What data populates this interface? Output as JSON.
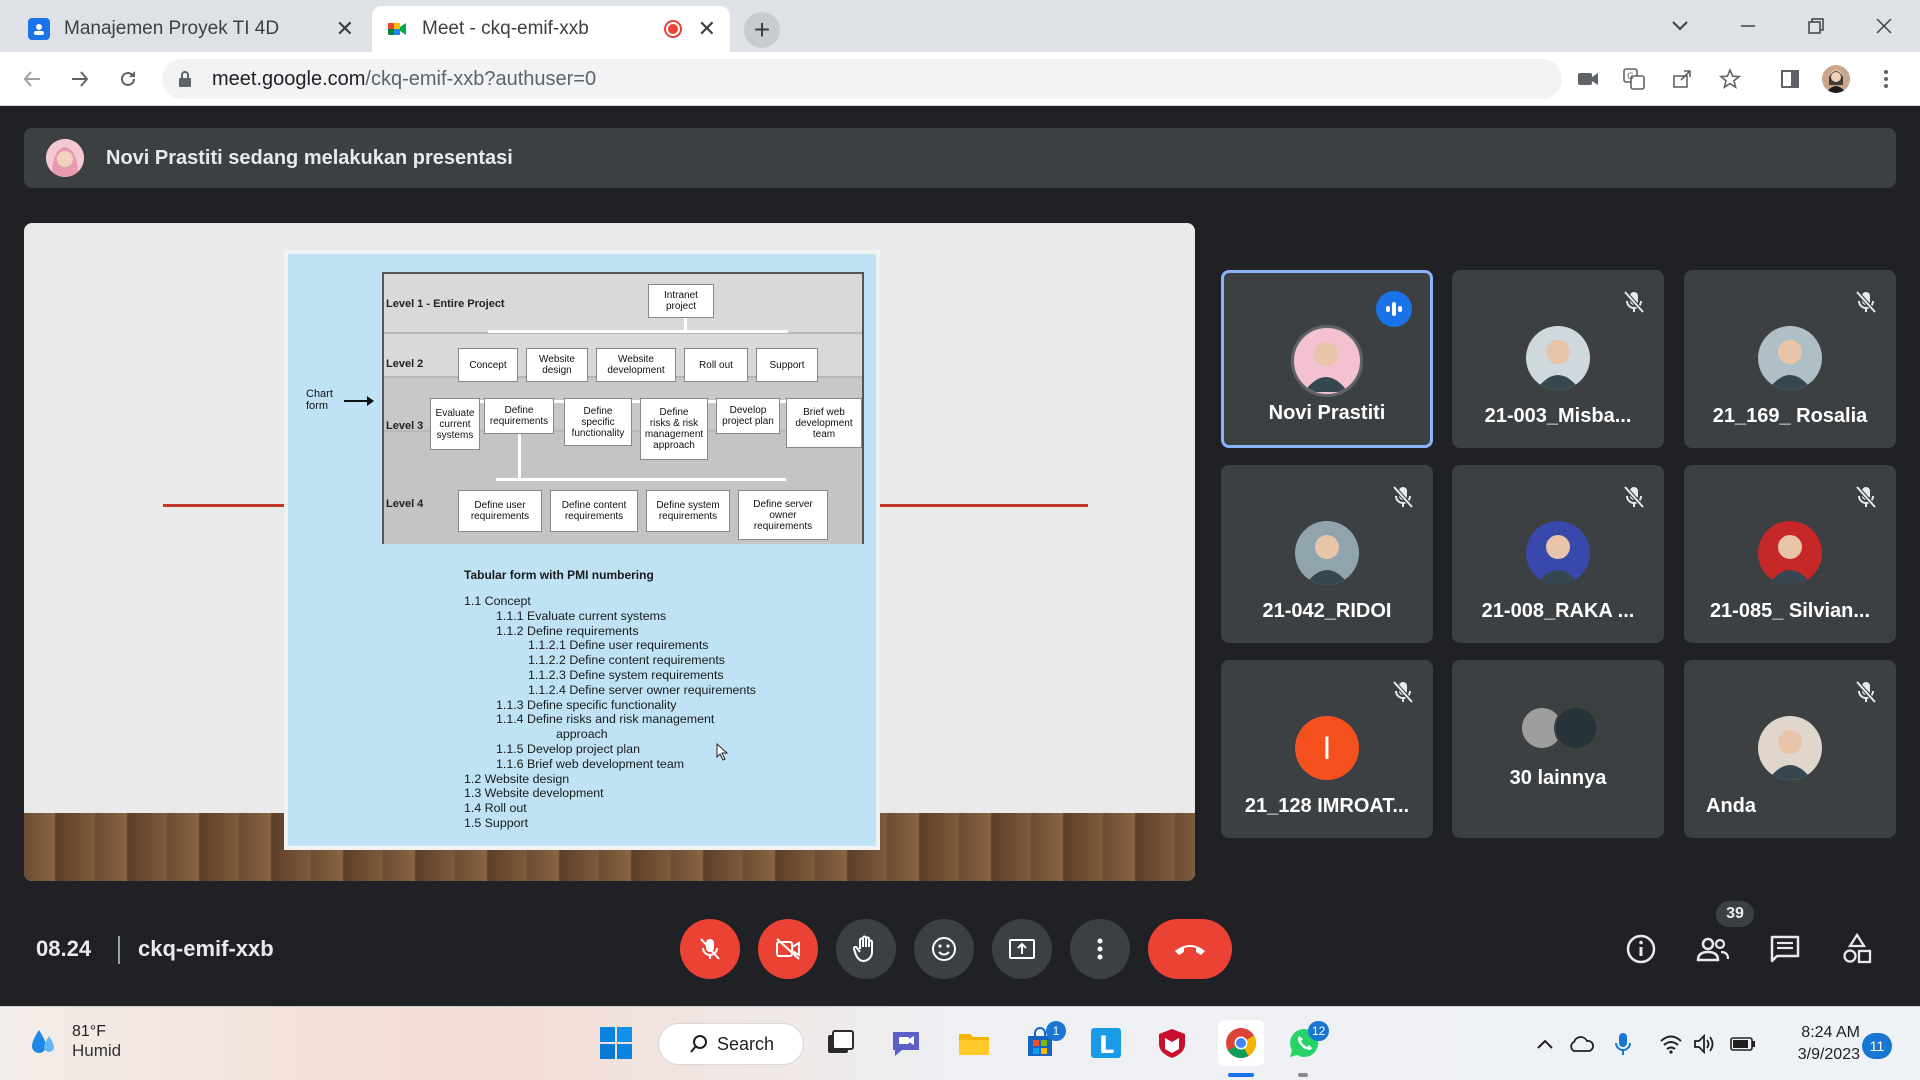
{
  "browser": {
    "tabs": [
      {
        "title": "Manajemen Proyek TI 4D",
        "close": "✕"
      },
      {
        "title": "Meet - ckq-emif-xxb",
        "close": "✕"
      }
    ],
    "url_host": "meet.google.com",
    "url_path": "/ckq-emif-xxb?authuser=0"
  },
  "meet": {
    "presenter_text": "Novi Prastiti sedang melakukan presentasi",
    "meeting_time": "08.24",
    "meeting_code": "ckq-emif-xxb",
    "participant_count": "39",
    "colors": {
      "accent": "#8ab4f8",
      "danger": "#ea4335",
      "tile": "#3c4043",
      "bg": "#202124"
    },
    "tiles": [
      {
        "name": "Novi Prastiti",
        "status": "speaking"
      },
      {
        "name": "21-003_Misba...",
        "status": "muted"
      },
      {
        "name": "21_169_ Rosalia",
        "status": "muted"
      },
      {
        "name": "21-042_RIDOI",
        "status": "muted"
      },
      {
        "name": "21-008_RAKA ...",
        "status": "muted"
      },
      {
        "name": "21-085_ Silvian...",
        "status": "muted"
      },
      {
        "name": "21_128 IMROAT...",
        "status": "muted",
        "initial": "I"
      },
      {
        "name": "30 lainnya",
        "status": "group"
      },
      {
        "name": "Anda",
        "status": "muted"
      }
    ]
  },
  "slide": {
    "chart_form_label": "Chart\nform",
    "levels": [
      "Level 1 - Entire Project",
      "Level 2",
      "Level 3",
      "Level 4"
    ],
    "level1": [
      "Intranet\nproject"
    ],
    "level2": [
      "Concept",
      "Website\ndesign",
      "Website\ndevelopment",
      "Roll out",
      "Support"
    ],
    "level3": [
      "Evaluate\ncurrent\nsystems",
      "Define\nrequirements",
      "Define\nspecific\nfunctionality",
      "Define\nrisks & risk\nmanagement\napproach",
      "Develop\nproject plan",
      "Brief web\ndevelopment\nteam"
    ],
    "level4": [
      "Define user\nrequirements",
      "Define content\nrequirements",
      "Define system\nrequirements",
      "Define server\nowner\nrequirements"
    ],
    "tabular_title": "Tabular form with PMI numbering",
    "tabular_lines": [
      {
        "text": "1.1 Concept",
        "indent": 0
      },
      {
        "text": "1.1.1 Evaluate current systems",
        "indent": 1
      },
      {
        "text": "1.1.2 Define requirements",
        "indent": 1
      },
      {
        "text": "1.1.2.1 Define user requirements",
        "indent": 2
      },
      {
        "text": "1.1.2.2 Define content requirements",
        "indent": 2
      },
      {
        "text": "1.1.2.3 Define system requirements",
        "indent": 2
      },
      {
        "text": "1.1.2.4 Define server owner requirements",
        "indent": 2
      },
      {
        "text": "1.1.3 Define specific functionality",
        "indent": 1
      },
      {
        "text": "1.1.4 Define risks and risk management",
        "indent": 1
      },
      {
        "text": "approach",
        "indent": 3
      },
      {
        "text": "1.1.5 Develop project plan",
        "indent": 1
      },
      {
        "text": "1.1.6 Brief web development team",
        "indent": 1
      },
      {
        "text": "1.2 Website design",
        "indent": 0
      },
      {
        "text": "1.3 Website development",
        "indent": 0
      },
      {
        "text": "1.4 Roll out",
        "indent": 0
      },
      {
        "text": "1.5 Support",
        "indent": 0
      }
    ]
  },
  "taskbar": {
    "temperature": "81°F",
    "weather": "Humid",
    "search_label": "Search",
    "store_badge": "1",
    "whatsapp_badge": "12",
    "time": "8:24 AM",
    "date": "3/9/2023",
    "notifications": "11"
  }
}
